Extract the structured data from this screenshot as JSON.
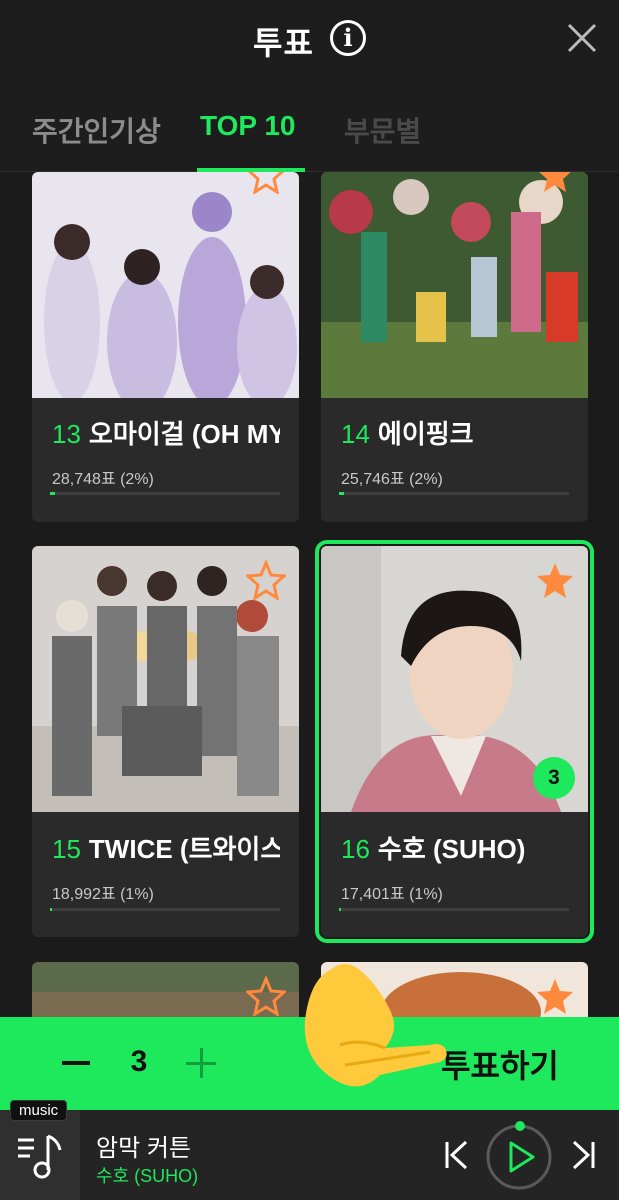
{
  "header": {
    "title": "투표",
    "info_icon": "info-icon",
    "close_icon": "close-icon"
  },
  "tabs": [
    {
      "label": "주간인기상",
      "active": false
    },
    {
      "label": "TOP 10",
      "active": true
    },
    {
      "label": "부문별",
      "active": false
    }
  ],
  "cards": [
    {
      "rank": "13",
      "name": "오마이걸 (OH MY GIRL)",
      "votes": "28,748표 (2%)",
      "percent": 2,
      "favorited": true,
      "selected": false,
      "photo": "oh-my-girl-photo"
    },
    {
      "rank": "14",
      "name": "에이핑크",
      "votes": "25,746표 (2%)",
      "percent": 2,
      "favorited": true,
      "selected": false,
      "photo": "apink-photo"
    },
    {
      "rank": "15",
      "name": "TWICE (트와이스)",
      "votes": "18,992표 (1%)",
      "percent": 1,
      "favorited": false,
      "selected": false,
      "photo": "twice-photo"
    },
    {
      "rank": "16",
      "name": "수호 (SUHO)",
      "votes": "17,401표 (1%)",
      "percent": 1,
      "favorited": true,
      "selected": true,
      "vote_count": "3",
      "photo": "suho-photo"
    }
  ],
  "vote_bar": {
    "quantity": "3",
    "vote_label": "투표하기"
  },
  "player": {
    "tag": "music",
    "song_title": "암막 커튼",
    "artist": "수호 (SUHO)"
  },
  "colors": {
    "accent": "#1ee85b",
    "background": "#1b1b1b",
    "card": "#2a2a2a",
    "star_filled": "#ff8a3d",
    "star_outline": "#ff8a3d"
  }
}
